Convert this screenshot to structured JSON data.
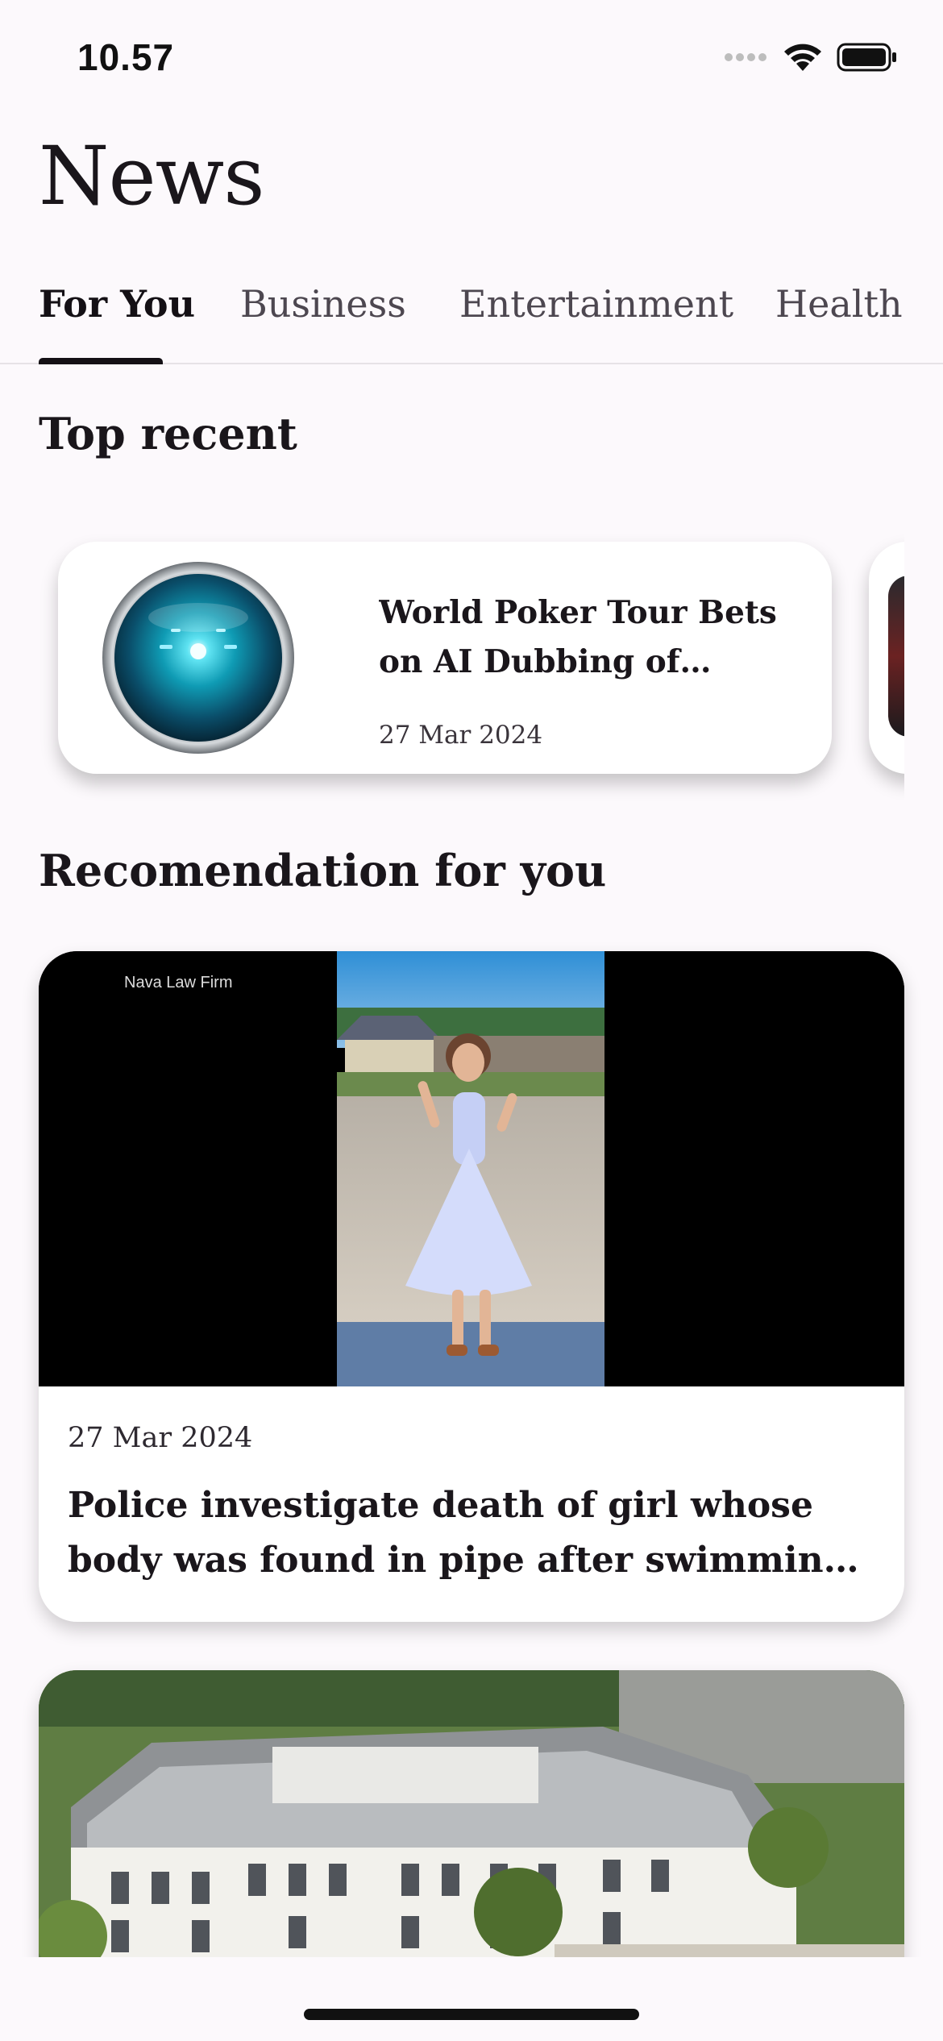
{
  "status_bar": {
    "time": "10.57",
    "icons": [
      "signal-dots-icon",
      "wifi-icon",
      "battery-icon"
    ]
  },
  "header": {
    "title": "News"
  },
  "tabs": [
    {
      "label": "For You",
      "active": true
    },
    {
      "label": "Business",
      "active": false
    },
    {
      "label": "Entertainment",
      "active": false
    },
    {
      "label": "Health",
      "active": false
    }
  ],
  "top_recent": {
    "heading": "Top recent",
    "items": [
      {
        "title": "World Poker Tour Bets on AI Dubbing of Tournaments for ...",
        "date": "27 Mar 2024",
        "thumbnail": "glowing-lens-image"
      }
    ]
  },
  "recommendations": {
    "heading": "Recomendation for you",
    "items": [
      {
        "image": "girl-in-blue-dress-photo",
        "watermark": "Nava Law Firm",
        "date": "27 Mar 2024",
        "title": "Police investigate death of girl whose body was found in pipe after swimming at a Texas hotel -..."
      },
      {
        "image": "aerial-mansion-photo"
      }
    ]
  },
  "colors": {
    "background": "#fcf9fc",
    "card": "#ffffff",
    "text": "#1a161b",
    "accent": "#141015"
  }
}
